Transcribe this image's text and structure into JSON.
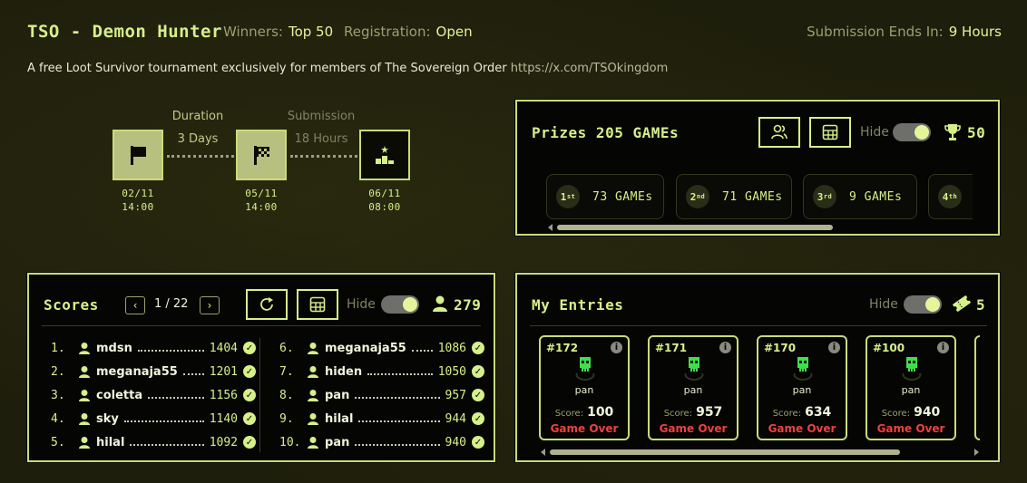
{
  "header": {
    "title": "TSO - Demon Hunter",
    "winners_label": "Winners:",
    "winners_value": "Top 50",
    "registration_label": "Registration:",
    "registration_value": "Open",
    "submission_label": "Submission Ends In:",
    "submission_value": "9 Hours",
    "description": "A free Loot Survivor tournament exclusively for members of The Sovereign Order",
    "link": "https://x.com/TSOkingdom"
  },
  "timeline": {
    "duration_label": "Duration",
    "duration_value": "3 Days",
    "submission_label": "Submission",
    "submission_value": "18 Hours",
    "start": {
      "date": "02/11",
      "time": "14:00",
      "icon": "flag-icon"
    },
    "end": {
      "date": "05/11",
      "time": "14:00",
      "icon": "checkered-flag-icon"
    },
    "final": {
      "date": "06/11",
      "time": "08:00",
      "icon": "podium-icon"
    }
  },
  "prizes": {
    "title": "Prizes 205 GAMEs",
    "hide_label": "Hide",
    "trophy_count": "50",
    "cards": [
      {
        "rank": "1",
        "suffix": "st",
        "amount": "73 GAMEs"
      },
      {
        "rank": "2",
        "suffix": "nd",
        "amount": "71 GAMEs"
      },
      {
        "rank": "3",
        "suffix": "rd",
        "amount": "9 GAMEs"
      },
      {
        "rank": "4",
        "suffix": "th",
        "amount": ""
      }
    ]
  },
  "scores": {
    "title": "Scores",
    "page": "1 / 22",
    "hide_label": "Hide",
    "player_count": "279",
    "rows": [
      {
        "rank": "1.",
        "name": "mdsn",
        "score": "1404"
      },
      {
        "rank": "2.",
        "name": "meganaja55",
        "score": "1201"
      },
      {
        "rank": "3.",
        "name": "coletta",
        "score": "1156"
      },
      {
        "rank": "4.",
        "name": "sky",
        "score": "1140"
      },
      {
        "rank": "5.",
        "name": "hilal",
        "score": "1092"
      },
      {
        "rank": "6.",
        "name": "meganaja55",
        "score": "1086"
      },
      {
        "rank": "7.",
        "name": "hiden",
        "score": "1050"
      },
      {
        "rank": "8.",
        "name": "pan",
        "score": "957"
      },
      {
        "rank": "9.",
        "name": "hilal",
        "score": "944"
      },
      {
        "rank": "10.",
        "name": "pan",
        "score": "940"
      }
    ]
  },
  "entries": {
    "title": "My Entries",
    "hide_label": "Hide",
    "count": "5",
    "items": [
      {
        "id": "#172",
        "player": "pan",
        "score_label": "Score:",
        "score": "100",
        "status": "Game Over"
      },
      {
        "id": "#171",
        "player": "pan",
        "score_label": "Score:",
        "score": "957",
        "status": "Game Over"
      },
      {
        "id": "#170",
        "player": "pan",
        "score_label": "Score:",
        "score": "634",
        "status": "Game Over"
      },
      {
        "id": "#100",
        "player": "pan",
        "score_label": "Score:",
        "score": "940",
        "status": "Game Over"
      }
    ]
  },
  "colors": {
    "accent": "#d6f08a",
    "background": "#1e1e0c",
    "panel": "#050503",
    "danger": "#f04040"
  }
}
